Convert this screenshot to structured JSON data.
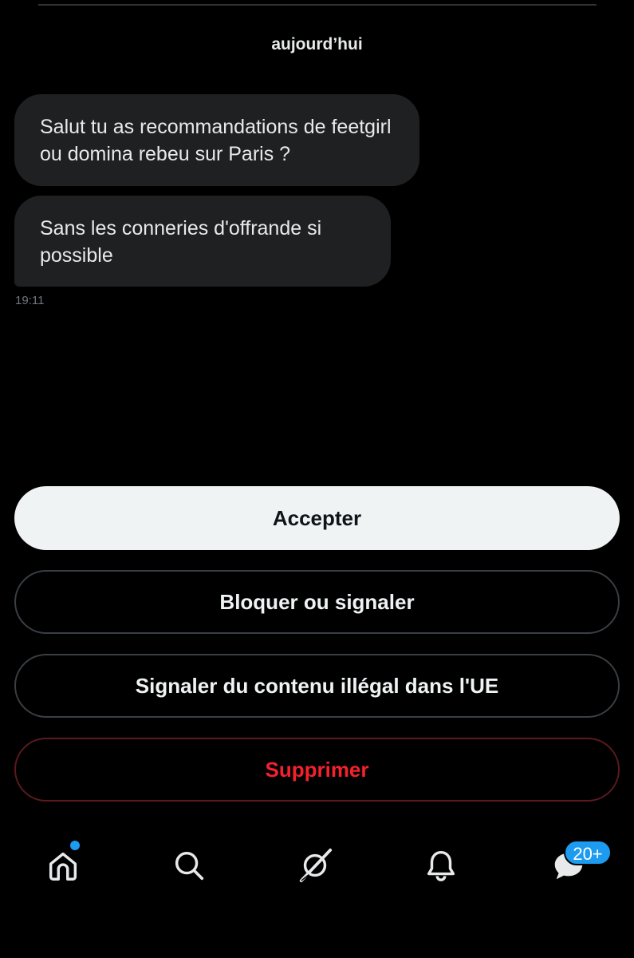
{
  "conversation": {
    "date_label": "aujourd’hui",
    "messages": [
      {
        "text": "Salut tu as recommandations de feetgirl ou domina rebeu sur Paris ?"
      },
      {
        "text": "Sans les conneries d'offrande si possible"
      }
    ],
    "timestamp": "19:11"
  },
  "request_actions": {
    "accept_label": "Accepter",
    "block_label": "Bloquer ou signaler",
    "report_eu_label": "Signaler du contenu illégal dans l'UE",
    "delete_label": "Supprimer"
  },
  "tabbar": {
    "items": [
      {
        "icon": "home-icon",
        "has_dot": true
      },
      {
        "icon": "search-icon"
      },
      {
        "icon": "grok-icon"
      },
      {
        "icon": "bell-icon"
      },
      {
        "icon": "messages-icon",
        "badge": "20+"
      }
    ]
  },
  "colors": {
    "background": "#000000",
    "bubble": "#1f2022",
    "accent": "#1d9bf0",
    "danger": "#f4212e",
    "primary_button": "#eff3f4"
  }
}
